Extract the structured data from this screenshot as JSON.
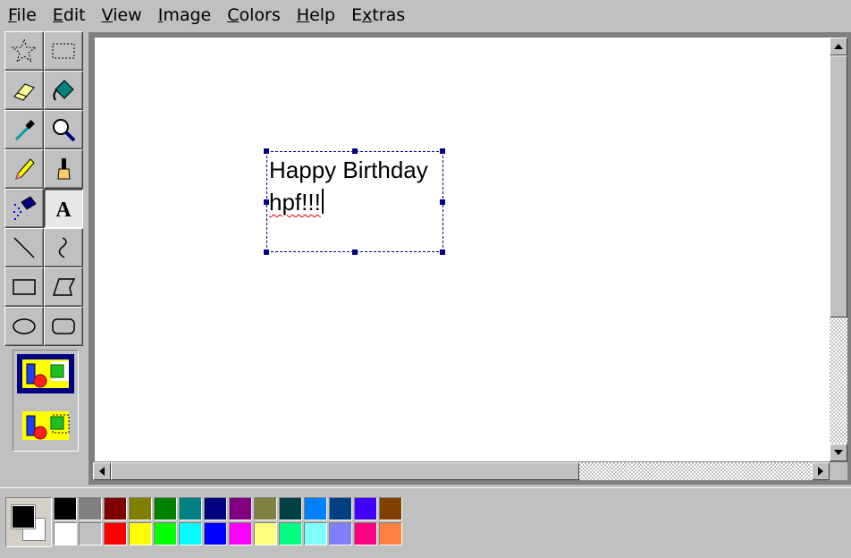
{
  "menu": [
    {
      "label": "File",
      "accel": "F",
      "rest": "ile"
    },
    {
      "label": "Edit",
      "accel": "E",
      "rest": "dit"
    },
    {
      "label": "View",
      "accel": "V",
      "rest": "iew"
    },
    {
      "label": "Image",
      "accel": "I",
      "rest": "mage"
    },
    {
      "label": "Colors",
      "accel": "C",
      "rest": "olors"
    },
    {
      "label": "Help",
      "accel": "H",
      "rest": "elp"
    },
    {
      "label": "Extras",
      "accel": "x",
      "pre": "E",
      "rest": "tras"
    }
  ],
  "tools": [
    {
      "name": "free-form-select-tool",
      "icon": "star-select-icon"
    },
    {
      "name": "rect-select-tool",
      "icon": "rect-select-icon"
    },
    {
      "name": "eraser-tool",
      "icon": "eraser-icon"
    },
    {
      "name": "fill-tool",
      "icon": "paint-bucket-icon"
    },
    {
      "name": "pick-color-tool",
      "icon": "eyedropper-icon"
    },
    {
      "name": "magnifier-tool",
      "icon": "magnifier-icon"
    },
    {
      "name": "pencil-tool",
      "icon": "pencil-icon"
    },
    {
      "name": "brush-tool",
      "icon": "brush-icon"
    },
    {
      "name": "airbrush-tool",
      "icon": "airbrush-icon"
    },
    {
      "name": "text-tool",
      "icon": "text-a-icon",
      "selected": true
    },
    {
      "name": "line-tool",
      "icon": "line-icon"
    },
    {
      "name": "curve-tool",
      "icon": "curve-icon"
    },
    {
      "name": "rectangle-tool",
      "icon": "rectangle-icon"
    },
    {
      "name": "polygon-tool",
      "icon": "polygon-icon"
    },
    {
      "name": "ellipse-tool",
      "icon": "ellipse-icon"
    },
    {
      "name": "rounded-rect-tool",
      "icon": "rounded-rect-icon"
    }
  ],
  "text_tool_options": [
    {
      "name": "opaque-background-option",
      "selected": true
    },
    {
      "name": "transparent-background-option",
      "selected": false
    }
  ],
  "canvas": {
    "text_line1": "Happy Birthday",
    "text_line2": "hpf!!!"
  },
  "colors": {
    "foreground": "#000000",
    "background": "#ffffff",
    "palette_top": [
      "#000000",
      "#808080",
      "#800000",
      "#808000",
      "#008000",
      "#008080",
      "#000080",
      "#800080",
      "#808040",
      "#004040",
      "#0080ff",
      "#004080",
      "#4000ff",
      "#804000"
    ],
    "palette_bottom": [
      "#ffffff",
      "#c0c0c0",
      "#ff0000",
      "#ffff00",
      "#00ff00",
      "#00ffff",
      "#0000ff",
      "#ff00ff",
      "#ffff80",
      "#00ff80",
      "#80ffff",
      "#8080ff",
      "#ff0080",
      "#ff8040"
    ]
  }
}
